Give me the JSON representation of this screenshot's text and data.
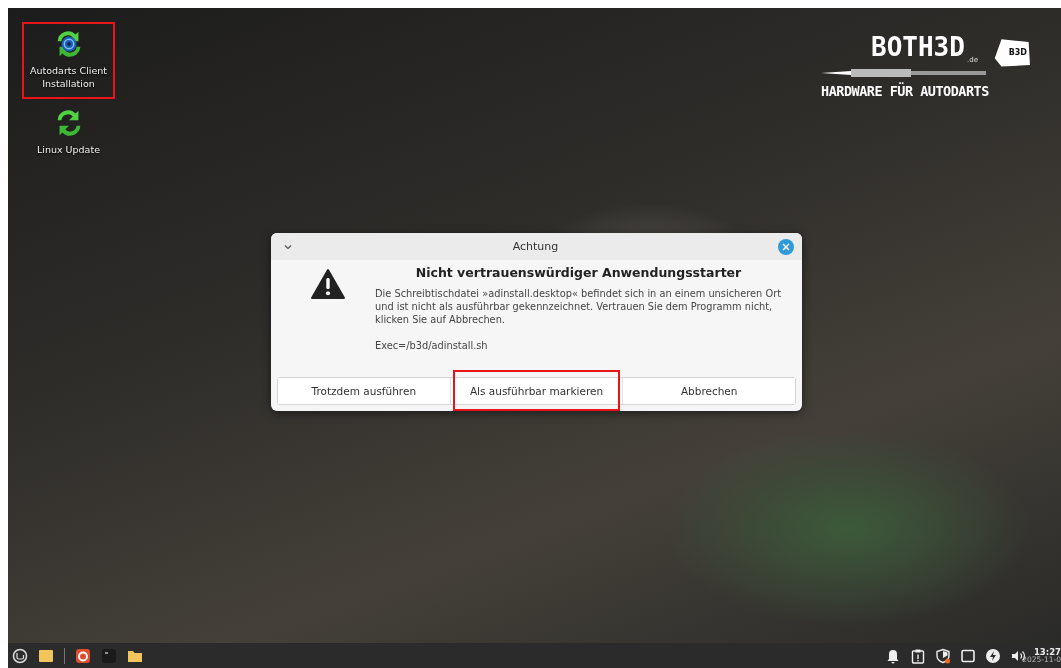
{
  "desktop": {
    "icons": [
      {
        "kind": "autodarts",
        "label": "Autodarts Client Installation",
        "highlighted": true
      },
      {
        "kind": "update",
        "label": "Linux Update",
        "highlighted": false
      }
    ],
    "wallpaper_logo": {
      "title": "BOTH3D",
      "domain": ".de",
      "badge": "B3D",
      "tagline": "HARDWARE FÜR AUTODARTS"
    }
  },
  "dialog": {
    "title": "Achtung",
    "heading": "Nicht vertrauenswürdiger Anwendungsstarter",
    "message": "Die Schreibtischdatei »adinstall.desktop« befindet sich in an einem unsicheren Ort und ist nicht als ausführbar gekennzeichnet. Vertrauen Sie dem Programm nicht, klicken Sie auf Abbrechen.",
    "command": "Exec=/b3d/adinstall.sh",
    "buttons": [
      {
        "label": "Trotzdem ausführen",
        "highlighted": false
      },
      {
        "label": "Als ausführbar markieren",
        "highlighted": true
      },
      {
        "label": "Abbrechen",
        "highlighted": false
      }
    ]
  },
  "taskbar": {
    "clock": {
      "time": "13:27",
      "date": "2025-11-0"
    }
  }
}
